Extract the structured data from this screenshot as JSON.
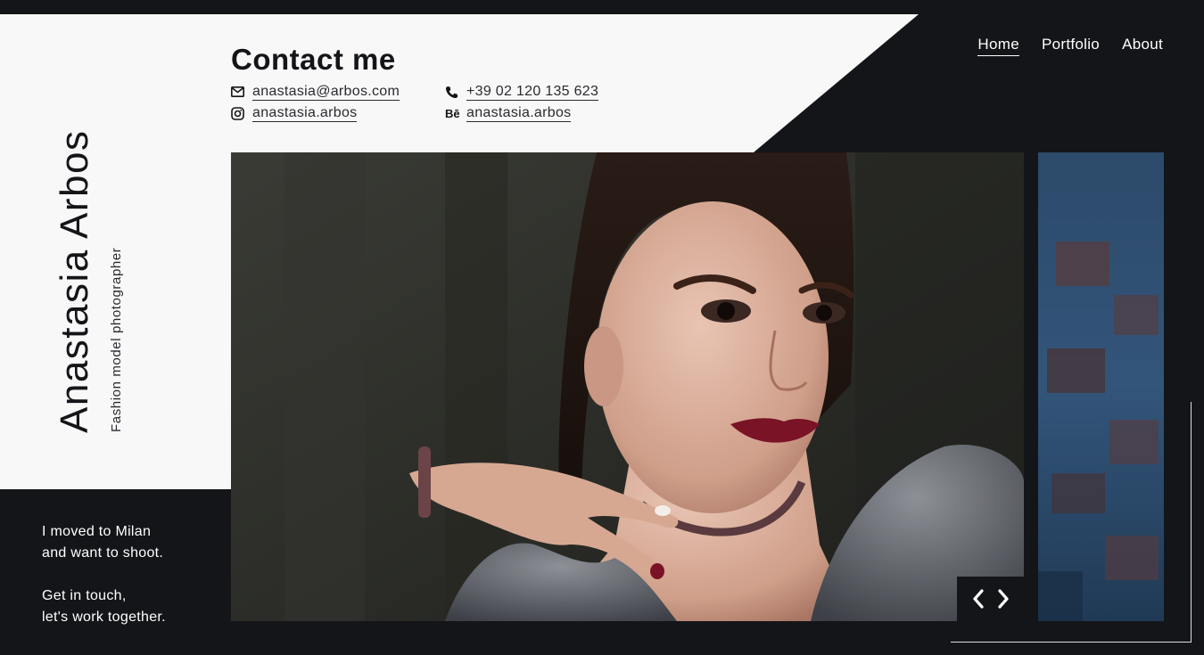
{
  "profile": {
    "name": "Anastasia Arbos",
    "role": "Fashion model photographer"
  },
  "contact": {
    "title": "Contact me",
    "email": "anastasia@arbos.com",
    "phone": "+39 02 120 135 623",
    "instagram": "anastasia.arbos",
    "behance": "anastasia.arbos",
    "behance_icon_text": "Bē"
  },
  "nav": {
    "items": [
      "Home",
      "Portfolio",
      "About"
    ],
    "active": "Home"
  },
  "tagline": {
    "line1": "I moved to Milan",
    "line2": "and want to shoot.",
    "line3": "Get in touch,",
    "line4": "let's work together."
  },
  "colors": {
    "background": "#141519",
    "panel": "#f8f8f8",
    "accent_lip": "#7a1326"
  },
  "slider": {
    "prev_icon": "chevron-left-icon",
    "next_icon": "chevron-right-icon"
  }
}
